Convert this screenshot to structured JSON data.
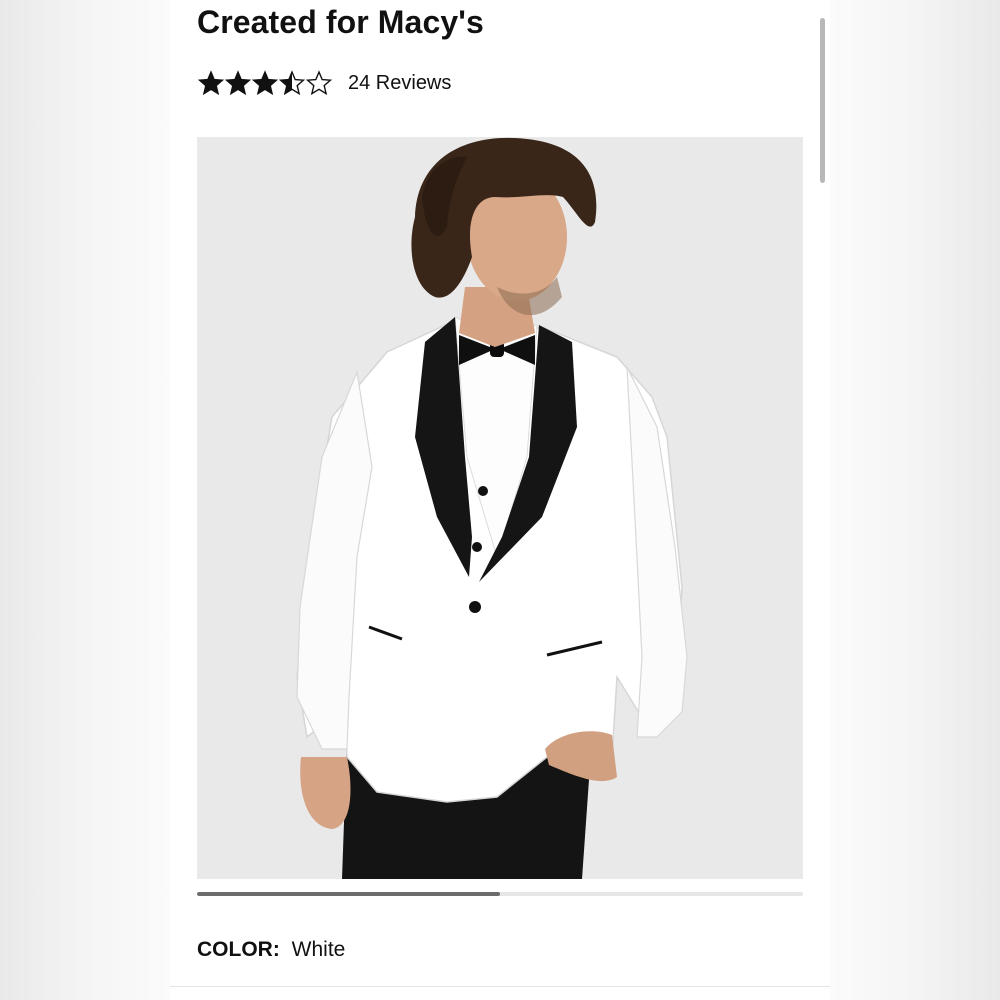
{
  "product": {
    "title": "Created for Macy's",
    "rating": {
      "value": 3.5,
      "max": 5,
      "reviews_label": "24 Reviews"
    },
    "image": {
      "icon": "product-photo-white-shawl-tuxedo-jacket",
      "carousel_progress": 0.5
    },
    "color": {
      "label": "COLOR:",
      "value": "White"
    }
  },
  "colors": {
    "star": "#111111",
    "progress_fill": "#6c6c6c",
    "progress_track": "#e6e6e6",
    "jacket": "#ffffff",
    "lapel": "#111111"
  }
}
